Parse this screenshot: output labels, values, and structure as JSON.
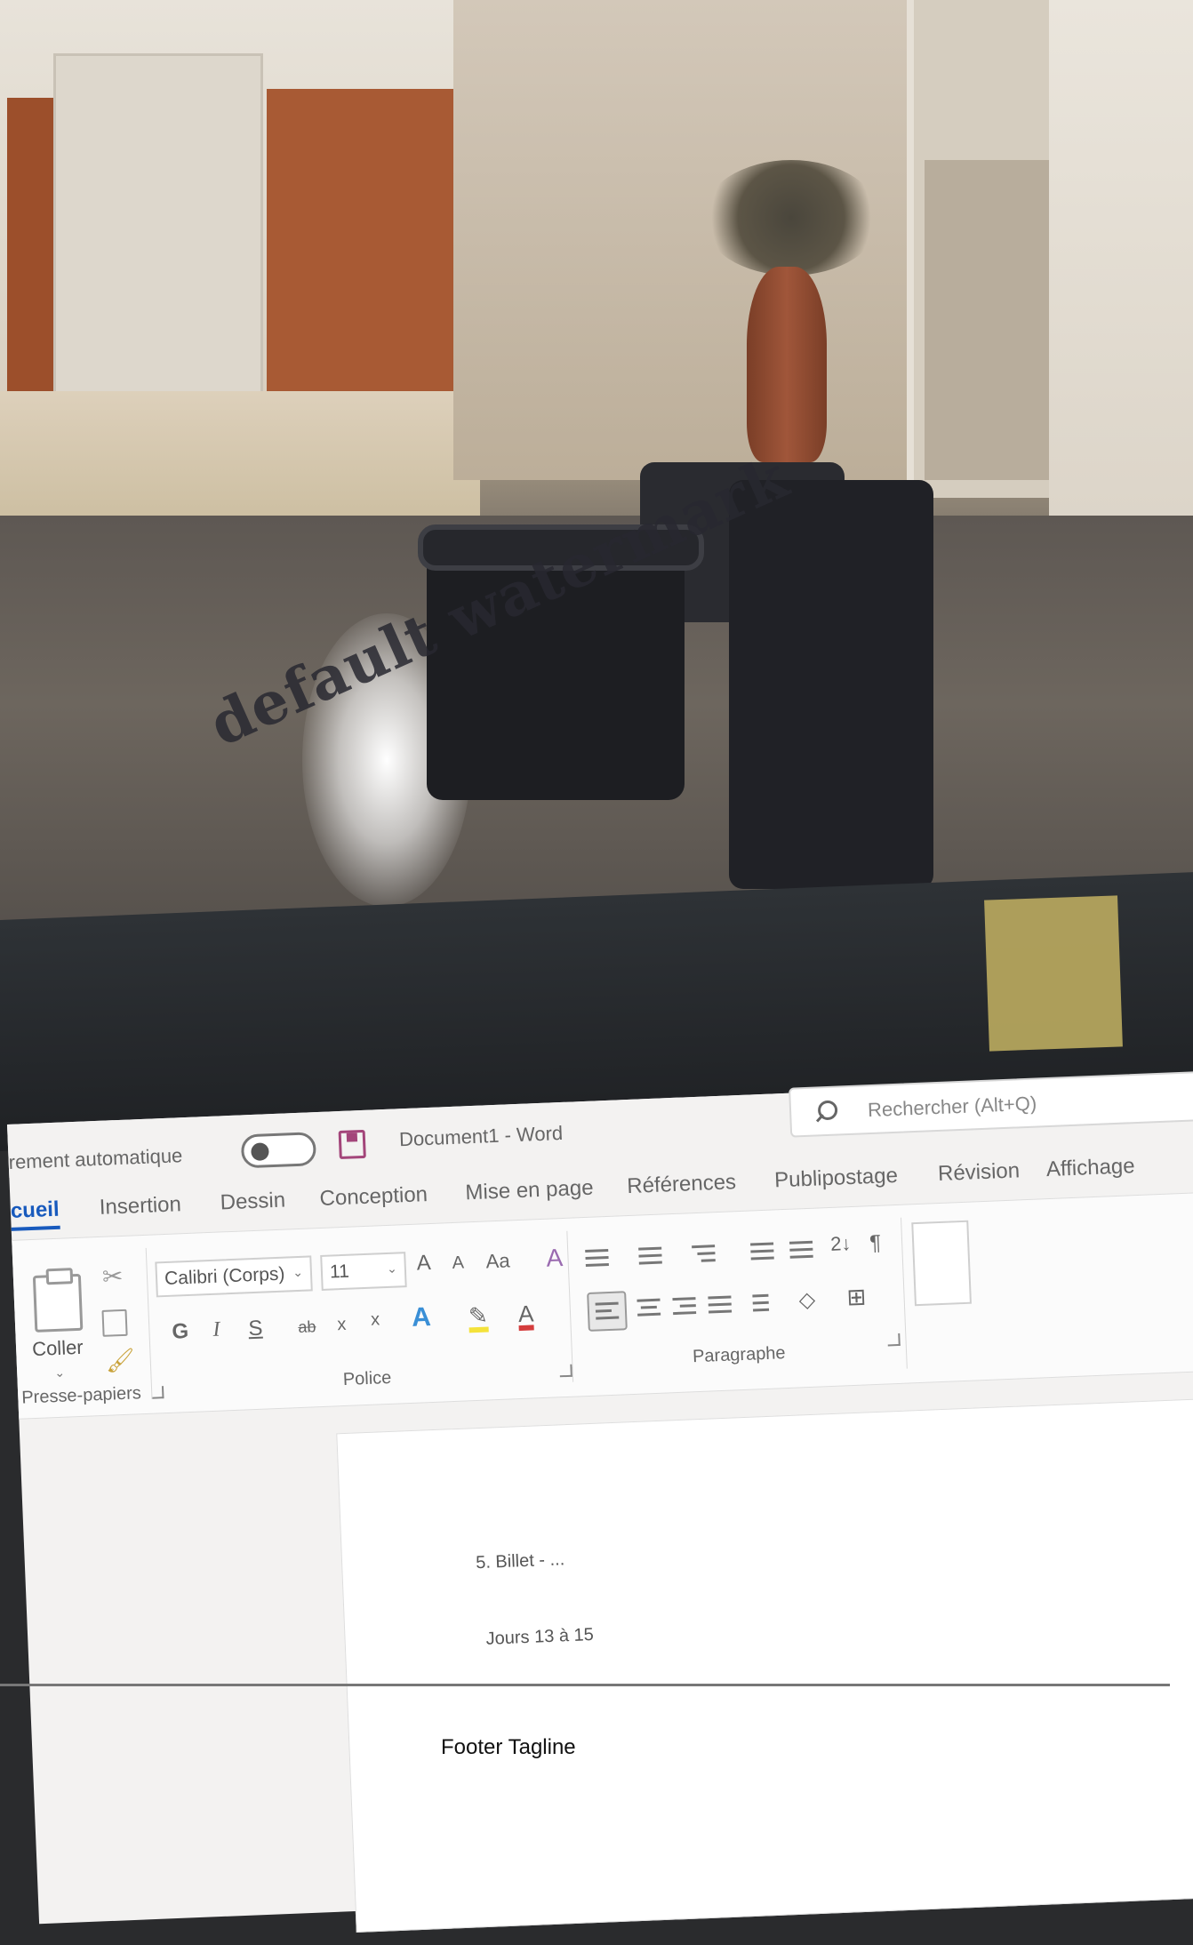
{
  "watermark": "default watermark",
  "titlebar": {
    "autosave_label": "rement automatique",
    "document_title": "Document1 - Word",
    "search_placeholder": "Rechercher (Alt+Q)"
  },
  "tabs": [
    {
      "label": "cueil",
      "active": true
    },
    {
      "label": "Insertion"
    },
    {
      "label": "Dessin"
    },
    {
      "label": "Conception"
    },
    {
      "label": "Mise en page"
    },
    {
      "label": "Références"
    },
    {
      "label": "Publipostage"
    },
    {
      "label": "Révision"
    },
    {
      "label": "Affichage"
    }
  ],
  "ribbon": {
    "clipboard": {
      "paste_label": "Coller",
      "group_label": "Presse-papiers"
    },
    "font": {
      "font_name": "Calibri (Corps)",
      "font_size": "11",
      "grow": "A",
      "shrink": "A",
      "case": "Aa",
      "clear": "A",
      "bold": "G",
      "italic": "I",
      "underline": "S",
      "strike": "ab",
      "subscript": "x",
      "superscript": "x",
      "effects": "A",
      "highlight": "✎",
      "color": "A",
      "group_label": "Police"
    },
    "paragraph": {
      "sort": "2↓",
      "pilcrow": "¶",
      "group_label": "Paragraphe"
    }
  },
  "document": {
    "line1": "5. Billet - ...",
    "line2": "Jours 13 à 15"
  },
  "footer": {
    "tagline": "Footer Tagline"
  },
  "colors": {
    "accent": "#185abd",
    "save_icon": "#a3457a",
    "highlight": "#f4e23a",
    "font_color": "#d43c3c"
  }
}
